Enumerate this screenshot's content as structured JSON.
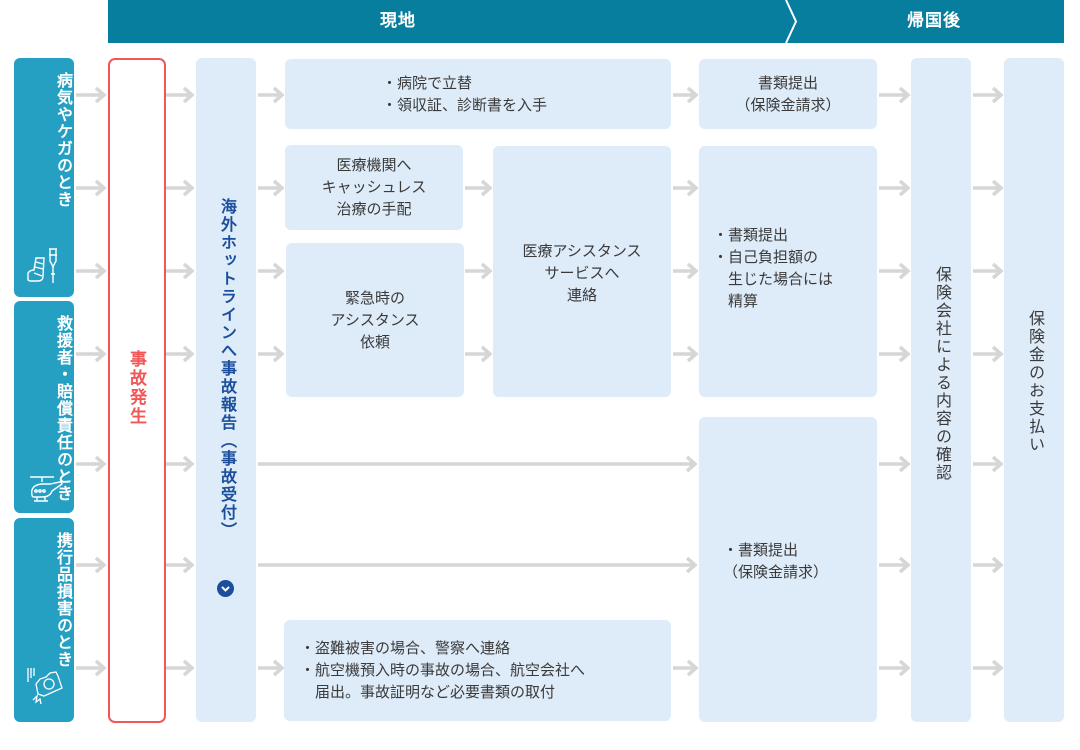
{
  "header": {
    "phase_on_site": "現地",
    "phase_after_return": "帰国後"
  },
  "categories": [
    {
      "label_lines": [
        "病気やケガのとき"
      ],
      "icon": "crutch-cast-icon"
    },
    {
      "label_lines": [
        "救援者・",
        "賠償責任のとき"
      ],
      "icon": "helicopter-icon"
    },
    {
      "label_lines": [
        "携行品損害",
        "のとき"
      ],
      "icon": "falling-camera-icon"
    }
  ],
  "event": {
    "label": "事故発生"
  },
  "hotline": {
    "label": "海外ホットラインへ事故報告（事故受付）",
    "icon": "chevron-down-circle-icon"
  },
  "on_site_steps": {
    "hospital_payment": [
      "・病院で立替",
      "・領収証、診断書を入手"
    ],
    "cashless": [
      "医療機関へ",
      "キャッシュレス",
      "治療の手配"
    ],
    "emergency_assist": [
      "緊急時の",
      "アシスタンス",
      "依頼"
    ],
    "medical_assist_service": [
      "医療アシスタンス",
      "サービスへ",
      "連絡"
    ],
    "theft_loss": [
      "・盗難被害の場合、警察へ連絡",
      "・航空機預入時の事故の場合、航空会社へ",
      "　届出。事故証明など必要書類の取付"
    ]
  },
  "after_return_steps": {
    "claim_1": [
      "書類提出",
      "（保険金請求）"
    ],
    "claim_2": [
      "・書類提出",
      "・自己負担額の",
      "　生じた場合には",
      "　精算"
    ],
    "claim_3": [
      "・書類提出",
      "（保険金請求）"
    ],
    "insurer_review": "保険会社による内容の確認",
    "payment": "保険金のお支払い"
  },
  "colors": {
    "header": "#087e9f",
    "category": "#25a0c3",
    "event_accent": "#f25757",
    "box": "#deebf8",
    "hotline_text": "#1b4f9c",
    "arrow": "#d6d6d6"
  }
}
